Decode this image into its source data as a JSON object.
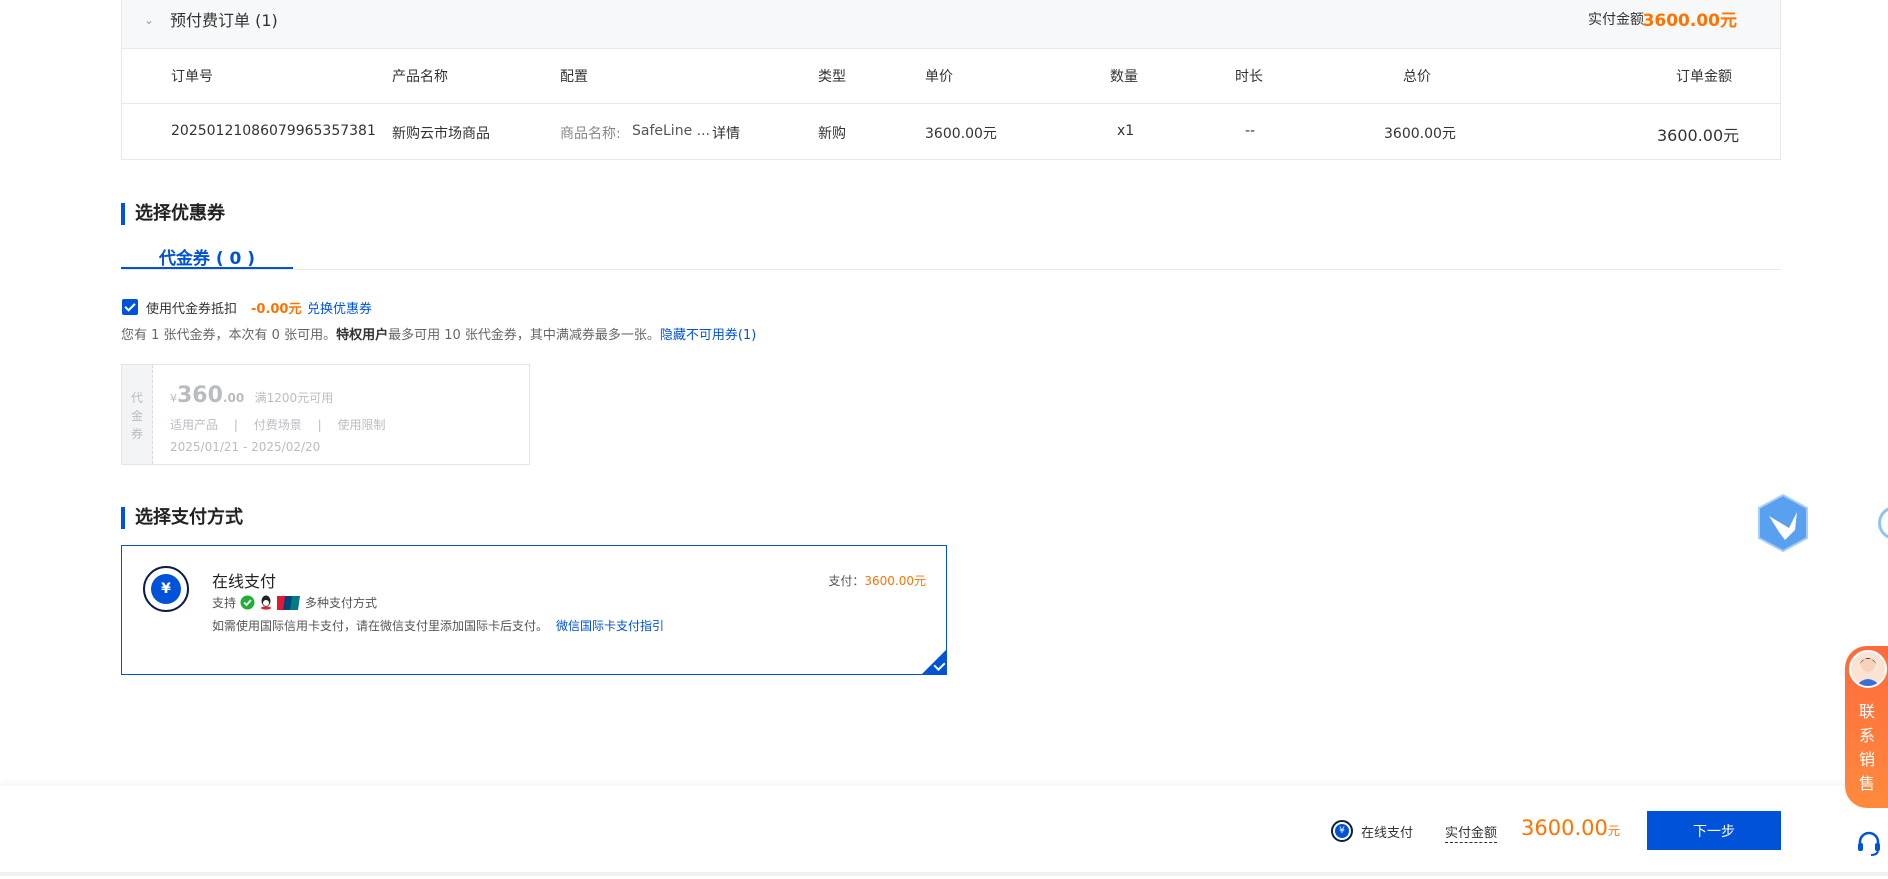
{
  "order": {
    "title": "预付费订单 (1)",
    "paid_label": "实付金额",
    "paid_value": "3600.00元",
    "columns": [
      "订单号",
      "产品名称",
      "配置",
      "类型",
      "单价",
      "数量",
      "时长",
      "总价",
      "订单金额"
    ],
    "row": {
      "order_no": "20250121086079965357381",
      "product": "新购云市场商品",
      "config_label": "商品名称:",
      "config_value": "SafeLine ...",
      "detail_link": "详情",
      "type": "新购",
      "unit_price": "3600.00元",
      "quantity": "x1",
      "duration": "--",
      "total": "3600.00元",
      "amount": "3600.00元"
    }
  },
  "coupon_section": {
    "title": "选择优惠券",
    "tab_label": "代金券 ( 0 )",
    "use_label": "使用代金券抵扣",
    "deduct": "-0.00元",
    "exchange_link": "兑换优惠券",
    "info_prefix": "您有 1 张代金券，本次有 0 张可用。",
    "info_bold": "特权用户",
    "info_suffix": "最多可用 10 张代金券，其中满减券最多一张。",
    "hide_link": "隐藏不可用券(1)",
    "card": {
      "side_label": [
        "代",
        "金",
        "券"
      ],
      "currency": "¥",
      "amount_int": "360",
      "amount_dec": ".00",
      "condition": "满1200元可用",
      "meta": [
        "适用产品",
        "付费场景",
        "使用限制"
      ],
      "separator": "|",
      "validity": "2025/01/21 - 2025/02/20"
    }
  },
  "payment_section": {
    "title": "选择支付方式",
    "method_title": "在线支付",
    "pay_label": "支付：",
    "pay_value": "3600.00元",
    "support_prefix": "支持",
    "support_suffix": "多种支付方式",
    "note": "如需使用国际信用卡支付，请在微信支付里添加国际卡后支付。",
    "guide_link": "微信国际卡支付指引"
  },
  "bottom_bar": {
    "method": "在线支付",
    "paid_label": "实付金额",
    "amount": "3600.00",
    "unit": "元",
    "next_button": "下一步"
  },
  "widgets": {
    "sales_label": [
      "联",
      "系",
      "销",
      "售"
    ]
  },
  "colors": {
    "brand": "#0052d9",
    "price": "#ff7200",
    "sales_gradient_top": "#ff6a3d"
  }
}
